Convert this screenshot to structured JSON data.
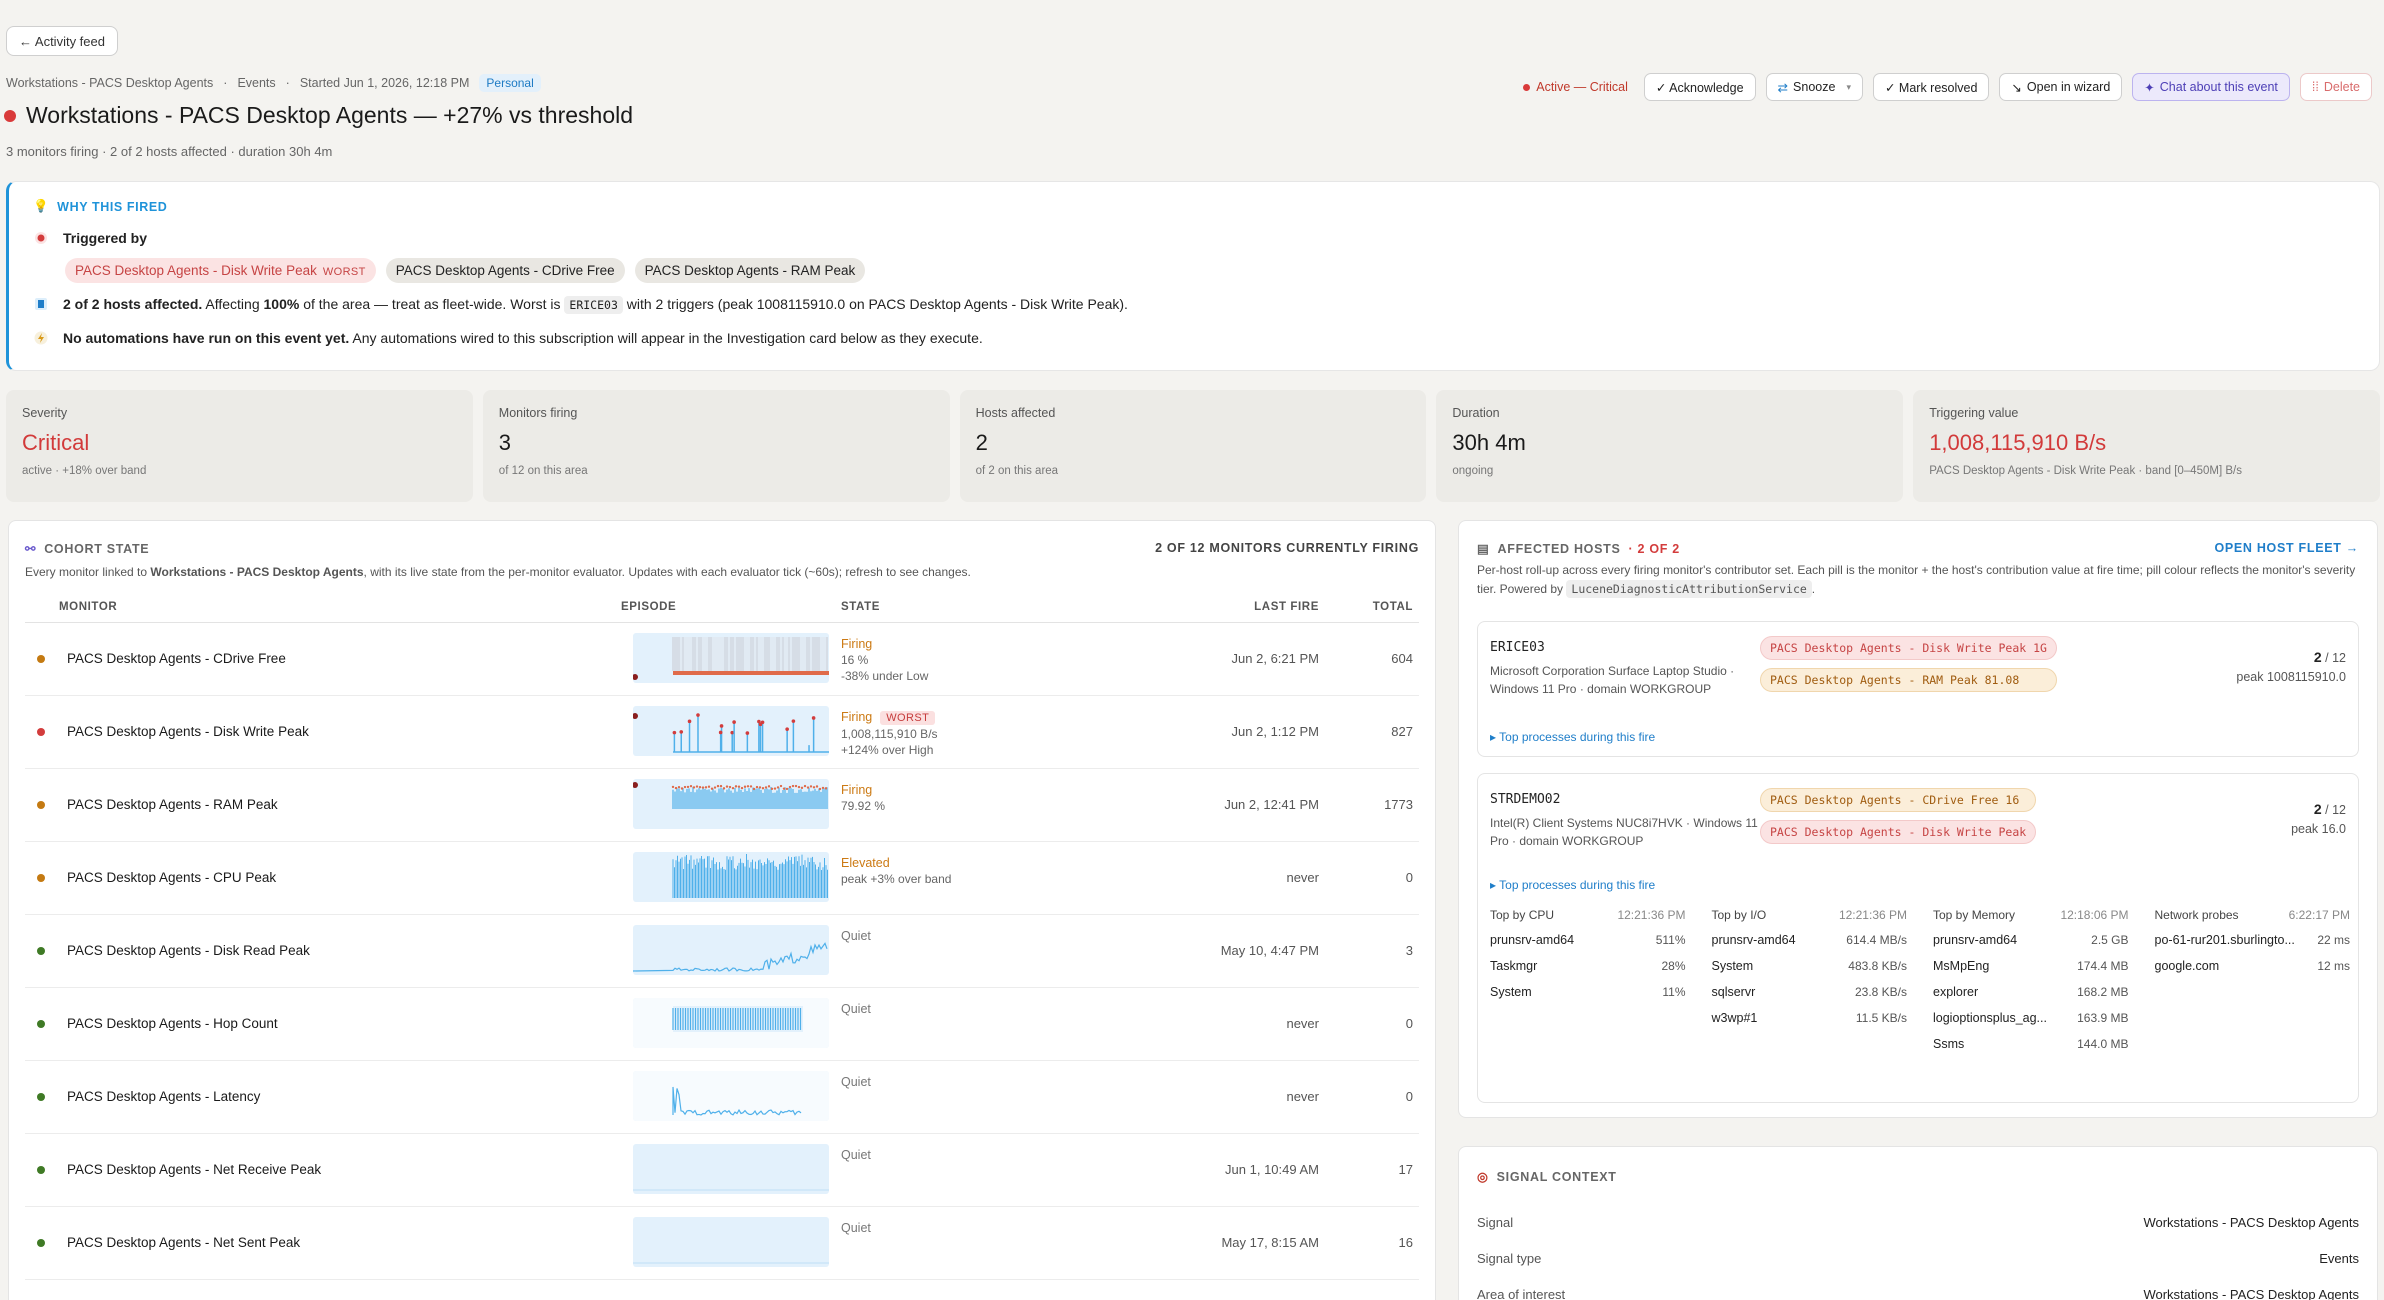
{
  "nav": {
    "back_label": "← Activity feed"
  },
  "breadcrumb": {
    "area": "Workstations - PACS Desktop Agents",
    "section": "Events",
    "started": "Started  Jun 1, 2026, 12:18 PM",
    "scope": "Personal"
  },
  "header": {
    "title": "Workstations - PACS Desktop Agents — +27% vs threshold",
    "subtitle": "3 monitors firing · 2 of 2 hosts affected · duration 30h 4m"
  },
  "actions": {
    "status": "Active — Critical",
    "acknowledge": "✓ Acknowledge",
    "snooze": "Snooze",
    "mark_resolved": "✓ Mark resolved",
    "open_wizard": "Open in wizard",
    "chat": "Chat about this event",
    "delete": "Delete"
  },
  "why": {
    "heading": "WHY THIS FIRED",
    "triggered_by": "Triggered by",
    "triggers": [
      {
        "label": "PACS Desktop Agents - Disk Write Peak",
        "tag": "WORST"
      },
      {
        "label": "PACS Desktop Agents - CDrive Free"
      },
      {
        "label": "PACS Desktop Agents - RAM Peak"
      }
    ],
    "hosts_bold": "2 of 2 hosts affected.",
    "hosts_text_a": "Affecting",
    "hosts_pct": "100%",
    "hosts_text_b": "of the area — treat as fleet-wide. Worst is",
    "hosts_worst": "ERICE03",
    "hosts_text_c": "with 2 triggers (peak 1008115910.0 on PACS Desktop Agents - Disk Write Peak).",
    "auto_bold": "No automations have run on this event yet.",
    "auto_text": "Any automations wired to this subscription will appear in the Investigation card below as they execute."
  },
  "stats": [
    {
      "label": "Severity",
      "value": "Critical",
      "sub": "active · +18% over band",
      "red": true
    },
    {
      "label": "Monitors firing",
      "value": "3",
      "sub": "of 12 on this area"
    },
    {
      "label": "Hosts affected",
      "value": "2",
      "sub": "of 2 on this area"
    },
    {
      "label": "Duration",
      "value": "30h 4m",
      "sub": "ongoing"
    },
    {
      "label": "Triggering value",
      "value": "1,008,115,910 B/s",
      "sub": "PACS Desktop Agents - Disk Write Peak · band [0–450M] B/s",
      "red": true
    }
  ],
  "cohort": {
    "title": "COHORT STATE",
    "firing_count": "2 OF 12 MONITORS CURRENTLY FIRING",
    "desc_a": "Every monitor linked to",
    "desc_bold": "Workstations - PACS Desktop Agents",
    "desc_b": ", with its live state from the per-monitor evaluator. Updates with each evaluator tick (~60s); refresh to see changes.",
    "columns": {
      "monitor": "MONITOR",
      "episode": "EPISODE",
      "state": "STATE",
      "last_fire": "LAST FIRE",
      "total": "TOTAL"
    },
    "rows": [
      {
        "name": "PACS Desktop Agents - CDrive Free",
        "dot": "#c47a12",
        "state": "Firing",
        "state_class": "firing",
        "line1": "16 %",
        "line2": "-38% under Low",
        "last": "Jun 2, 6:21 PM",
        "total": "604",
        "spark": "cdrive"
      },
      {
        "name": "PACS Desktop Agents - Disk Write Peak",
        "dot": "#d33c3c",
        "state": "Firing",
        "state_class": "firing",
        "worst": "WORST",
        "line1": "1,008,115,910 B/s",
        "line2": "+124% over High",
        "last": "Jun 2, 1:12 PM",
        "total": "827",
        "spark": "spikes"
      },
      {
        "name": "PACS Desktop Agents - RAM Peak",
        "dot": "#c47a12",
        "state": "Firing",
        "state_class": "firing",
        "line1": "79.92 %",
        "line2": "",
        "last": "Jun 2, 12:41 PM",
        "total": "1773",
        "spark": "ram"
      },
      {
        "name": "PACS Desktop Agents - CPU Peak",
        "dot": "#c47a12",
        "state": "Elevated",
        "state_class": "elev",
        "line1": "peak +3% over band",
        "line2": "",
        "last": "never",
        "total": "0",
        "spark": "dense"
      },
      {
        "name": "PACS Desktop Agents - Disk Read Peak",
        "dot": "#3f7a25",
        "state": "Quiet",
        "state_class": "quiet",
        "line1": "",
        "line2": "",
        "last": "May 10, 4:47 PM",
        "total": "3",
        "spark": "rising"
      },
      {
        "name": "PACS Desktop Agents - Hop Count",
        "dot": "#3f7a25",
        "state": "Quiet",
        "state_class": "quiet",
        "line1": "",
        "line2": "",
        "last": "never",
        "total": "0",
        "spark": "hop"
      },
      {
        "name": "PACS Desktop Agents - Latency",
        "dot": "#3f7a25",
        "state": "Quiet",
        "state_class": "quiet",
        "line1": "",
        "line2": "",
        "last": "never",
        "total": "0",
        "spark": "latency"
      },
      {
        "name": "PACS Desktop Agents - Net Receive Peak",
        "dot": "#3f7a25",
        "state": "Quiet",
        "state_class": "quiet",
        "line1": "",
        "line2": "",
        "last": "Jun 1, 10:49 AM",
        "total": "17",
        "spark": "flat"
      },
      {
        "name": "PACS Desktop Agents - Net Sent Peak",
        "dot": "#3f7a25",
        "state": "Quiet",
        "state_class": "quiet",
        "line1": "",
        "line2": "",
        "last": "May 17, 8:15 AM",
        "total": "16",
        "spark": "flat"
      }
    ]
  },
  "hosts": {
    "title": "AFFECTED HOSTS",
    "count": "· 2 OF 2",
    "open_fleet": "OPEN HOST FLEET →",
    "desc_a": "Per-host roll-up across every firing monitor's contributor set. Each pill is the monitor + the host's contribution value at fire time; pill colour reflects the monitor's severity tier. Powered by",
    "desc_code": "LuceneDiagnosticAttributionService",
    "desc_b": ".",
    "top_processes": "▸ Top processes during this fire",
    "items": [
      {
        "name": "ERICE03",
        "desc": "Microsoft Corporation Surface Laptop Studio · Windows 11 Pro · domain WORKGROUP",
        "pills": [
          {
            "text": "PACS Desktop Agents - Disk Write Peak 1G",
            "tone": "red"
          },
          {
            "text": "PACS Desktop Agents - RAM Peak 81.08",
            "tone": "amb"
          }
        ],
        "count": "2",
        "of": "/ 12",
        "peak": "peak 1008115910.0"
      },
      {
        "name": "STRDEMO02",
        "desc": "Intel(R) Client Systems NUC8i7HVK · Windows 11 Pro · domain WORKGROUP",
        "pills": [
          {
            "text": "PACS Desktop Agents - CDrive Free 16",
            "tone": "amb"
          },
          {
            "text": "PACS Desktop Agents - Disk Write Peak",
            "tone": "red"
          }
        ],
        "count": "2",
        "of": "/ 12",
        "peak": "peak 16.0"
      }
    ],
    "processes": [
      {
        "title": "Top by CPU",
        "time": "12:21:36 PM",
        "rows": [
          [
            "prunsrv-amd64",
            "511%"
          ],
          [
            "Taskmgr",
            "28%"
          ],
          [
            "System",
            "11%"
          ]
        ]
      },
      {
        "title": "Top by I/O",
        "time": "12:21:36 PM",
        "rows": [
          [
            "prunsrv-amd64",
            "614.4 MB/s"
          ],
          [
            "System",
            "483.8 KB/s"
          ],
          [
            "sqlservr",
            "23.8 KB/s"
          ],
          [
            "w3wp#1",
            "11.5 KB/s"
          ]
        ]
      },
      {
        "title": "Top by Memory",
        "time": "12:18:06 PM",
        "rows": [
          [
            "prunsrv-amd64",
            "2.5 GB"
          ],
          [
            "MsMpEng",
            "174.4 MB"
          ],
          [
            "explorer",
            "168.2 MB"
          ],
          [
            "logioptionsplus_ag...",
            "163.9 MB"
          ],
          [
            "Ssms",
            "144.0 MB"
          ]
        ]
      },
      {
        "title": "Network probes",
        "time": "6:22:17 PM",
        "rows": [
          [
            "po-61-rur201.sburlingto...",
            "22 ms"
          ],
          [
            "google.com",
            "12 ms"
          ]
        ]
      }
    ]
  },
  "signal": {
    "title": "SIGNAL CONTEXT",
    "rows": [
      {
        "label": "Signal",
        "value": "Workstations - PACS Desktop Agents"
      },
      {
        "label": "Signal type",
        "value": "Events"
      },
      {
        "label": "Area of interest",
        "value": "Workstations - PACS Desktop Agents"
      }
    ]
  }
}
